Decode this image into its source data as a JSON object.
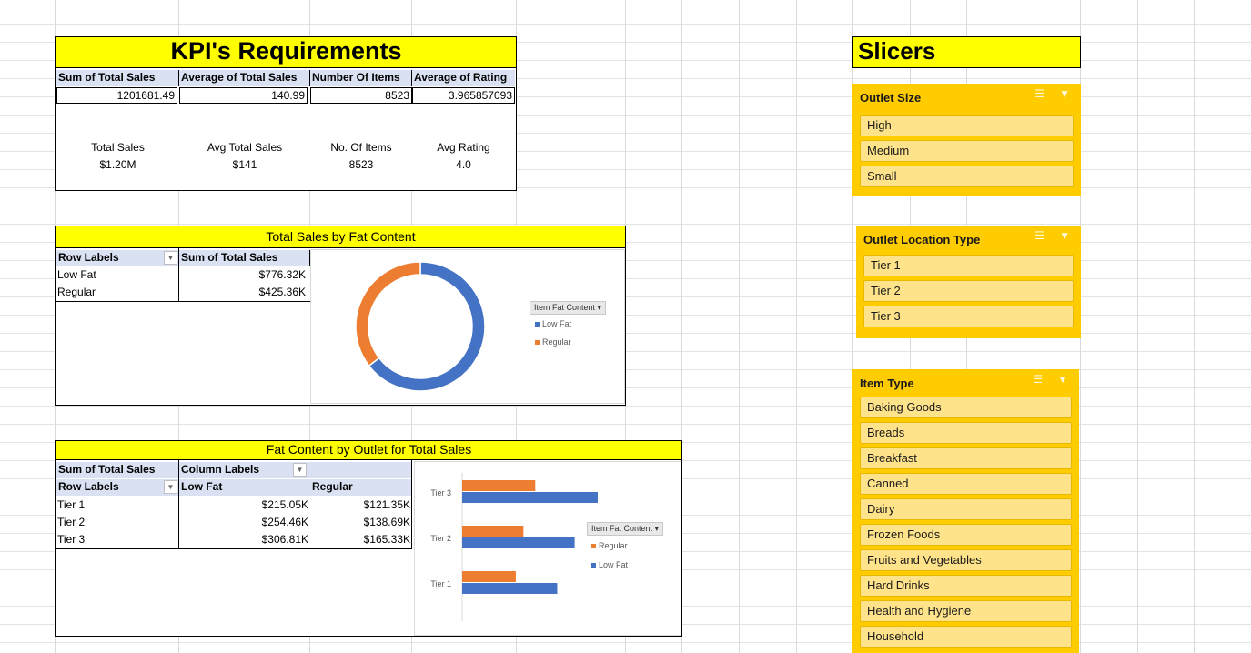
{
  "kpi": {
    "title": "KPI's Requirements",
    "headers": [
      "Sum of Total Sales",
      "Average of Total Sales",
      "Number Of Items",
      "Average of Rating"
    ],
    "values": [
      "1201681.49",
      "140.99",
      "8523",
      "3.965857093"
    ],
    "cards": [
      {
        "label": "Total Sales",
        "value": "$1.20M"
      },
      {
        "label": "Avg Total Sales",
        "value": "$141"
      },
      {
        "label": "No. Of Items",
        "value": "8523"
      },
      {
        "label": "Avg Rating",
        "value": "4.0"
      }
    ]
  },
  "fat_content": {
    "title": "Total Sales by Fat Content",
    "row_labels_header": "Row Labels",
    "value_header": "Sum of Total Sales",
    "rows": [
      {
        "label": "Low Fat",
        "value": "$776.32K"
      },
      {
        "label": "Regular",
        "value": "$425.36K"
      }
    ],
    "legend_button": "Item Fat Content",
    "legend_items": [
      "Low Fat",
      "Regular"
    ]
  },
  "outlet_table": {
    "title": "Fat Content by Outlet for Total Sales",
    "corner_header": "Sum of Total Sales",
    "column_labels_header": "Column Labels",
    "row_labels_header": "Row Labels",
    "col_low_fat": "Low Fat",
    "col_regular": "Regular",
    "rows": [
      {
        "label": "Tier 1",
        "low_fat": "$215.05K",
        "regular": "$121.35K"
      },
      {
        "label": "Tier 2",
        "low_fat": "$254.46K",
        "regular": "$138.69K"
      },
      {
        "label": "Tier 3",
        "low_fat": "$306.81K",
        "regular": "$165.33K"
      }
    ],
    "legend_button": "Item Fat Content",
    "legend_items": [
      "Regular",
      "Low Fat"
    ]
  },
  "chart_data": [
    {
      "type": "pie",
      "title": "",
      "categories": [
        "Low Fat",
        "Regular"
      ],
      "values": [
        776.32,
        425.36
      ],
      "colors": [
        "#4472c4",
        "#ed7d31"
      ],
      "donut": true,
      "legend": "right"
    },
    {
      "type": "bar",
      "orientation": "horizontal",
      "title": "",
      "categories": [
        "Tier 1",
        "Tier 2",
        "Tier 3"
      ],
      "series": [
        {
          "name": "Regular",
          "values": [
            121.35,
            138.69,
            165.33
          ],
          "color": "#ed7d31"
        },
        {
          "name": "Low Fat",
          "values": [
            215.05,
            254.46,
            306.81
          ],
          "color": "#4472c4"
        }
      ],
      "xlim": [
        0,
        350
      ],
      "grid": false,
      "legend": "right"
    }
  ],
  "slicers": {
    "header": "Slicers",
    "outlet_size": {
      "title": "Outlet Size",
      "items": [
        "High",
        "Medium",
        "Small"
      ]
    },
    "outlet_location": {
      "title": "Outlet Location Type",
      "items": [
        "Tier 1",
        "Tier 2",
        "Tier 3"
      ]
    },
    "item_type": {
      "title": "Item Type",
      "items": [
        "Baking Goods",
        "Breads",
        "Breakfast",
        "Canned",
        "Dairy",
        "Frozen Foods",
        "Fruits and Vegetables",
        "Hard Drinks",
        "Health and Hygiene",
        "Household"
      ]
    },
    "icons": {
      "multiselect": "multi-select-icon",
      "clear": "clear-filter-icon"
    }
  },
  "colors": {
    "yellow": "#ffff00",
    "slicer": "#ffcc00",
    "slicer_item": "#ffe38a",
    "low_fat": "#4472c4",
    "regular": "#ed7d31",
    "pivot_header": "#d9e1f2"
  }
}
